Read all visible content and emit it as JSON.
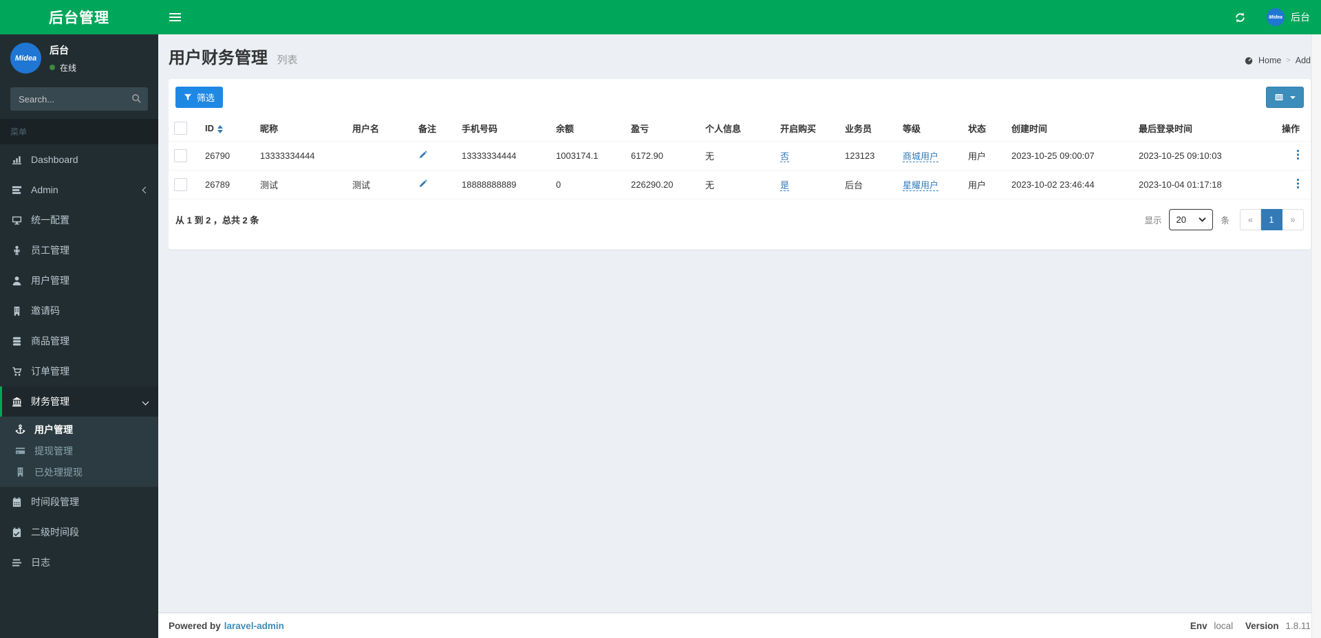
{
  "colors": {
    "navbar_green": "#00a65a",
    "sidebar_bg": "#222d32",
    "submenu_bg": "#2c3b41",
    "link_blue": "#337ab7",
    "filter_button_blue": "#1e88e5",
    "grid_button_blue": "#3c8dbc",
    "pagination_active_blue": "#337ab7",
    "avatar_blue": "#1f76d3",
    "content_bg": "#ecf0f5"
  },
  "logo": {
    "title": "后台管理"
  },
  "navbar": {
    "user_name": "后台",
    "avatar_text": "Midea",
    "refresh_icon": "refresh-icon",
    "hamburger_icon": "hamburger-icon"
  },
  "sidebar": {
    "user_panel": {
      "avatar_text": "Midea",
      "name": "后台",
      "status": "在线"
    },
    "search": {
      "placeholder": "Search...",
      "icon": "search-icon"
    },
    "menu_header": "菜单",
    "menu": [
      {
        "label": "Dashboard",
        "icon": "bar-chart-icon"
      },
      {
        "label": "Admin",
        "icon": "tasks-icon",
        "chevron": "left"
      },
      {
        "label": "统一配置",
        "icon": "desktop-icon"
      },
      {
        "label": "员工管理",
        "icon": "person-icon"
      },
      {
        "label": "用户管理",
        "icon": "user-icon"
      },
      {
        "label": "邀请码",
        "icon": "building-icon"
      },
      {
        "label": "商品管理",
        "icon": "database-icon"
      },
      {
        "label": "订单管理",
        "icon": "shopping-cart-icon"
      },
      {
        "label": "财务管理",
        "icon": "bank-icon",
        "chevron": "down",
        "active": true,
        "children": [
          {
            "label": "用户管理",
            "icon": "anchor-icon",
            "active": true
          },
          {
            "label": "提现管理",
            "icon": "credit-card-icon"
          },
          {
            "label": "已处理提现",
            "icon": "building-icon"
          }
        ]
      },
      {
        "label": "时间段管理",
        "icon": "calendar-icon"
      },
      {
        "label": "二级时间段",
        "icon": "calendar-check-icon"
      },
      {
        "label": "日志",
        "icon": "align-left-icon"
      }
    ]
  },
  "page": {
    "title": "用户财务管理",
    "subtitle": "列表",
    "breadcrumb": {
      "home_icon": "dashboard-icon",
      "home": "Home",
      "current": "Add"
    }
  },
  "toolbar": {
    "filter_label": "筛选",
    "filter_icon": "filter-icon",
    "grid_icon": "table-grid-icon"
  },
  "table": {
    "columns": [
      "ID",
      "昵称",
      "用户名",
      "备注",
      "手机号码",
      "余额",
      "盈亏",
      "个人信息",
      "开启购买",
      "业务员",
      "等级",
      "状态",
      "创建时间",
      "最后登录时间",
      "操作"
    ],
    "rows": [
      {
        "id": "26790",
        "nickname": "13333334444",
        "username": "",
        "phone": "13333334444",
        "balance": "1003174.1",
        "profit": "6172.90",
        "personal_info": "无",
        "buy_enabled": "否",
        "salesman": "123123",
        "level": "商城用户",
        "status": "用户",
        "created_at": "2023-10-25 09:00:07",
        "last_login_at": "2023-10-25 09:10:03"
      },
      {
        "id": "26789",
        "nickname": "测试",
        "username": "测试",
        "phone": "18888888889",
        "balance": "0",
        "profit": "226290.20",
        "personal_info": "无",
        "buy_enabled": "是",
        "salesman": "后台",
        "level": "星耀用户",
        "status": "用户",
        "created_at": "2023-10-02 23:46:44",
        "last_login_at": "2023-10-04 01:17:18"
      }
    ],
    "summary": "从 1 到 2 ，总共 2 条"
  },
  "pagination": {
    "show_label": "显示",
    "per_page": "20",
    "unit_label": "条",
    "prev": "«",
    "page": "1",
    "next": "»"
  },
  "footer": {
    "powered_by": "Powered by",
    "powered_link": "laravel-admin",
    "env_label": "Env",
    "env_value": "local",
    "version_label": "Version",
    "version_value": "1.8.11"
  }
}
